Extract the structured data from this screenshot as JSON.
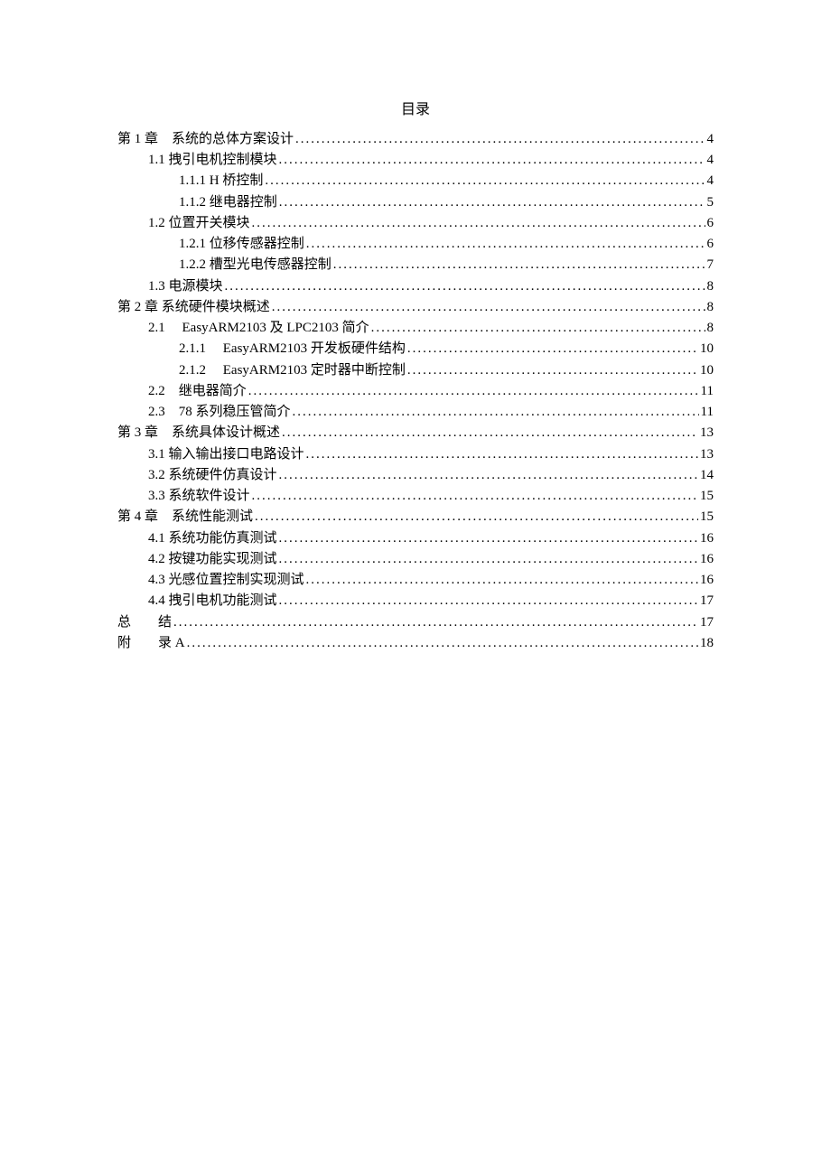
{
  "title": "目录",
  "toc": [
    {
      "indent": 0,
      "label": "第 1 章 系统的总体方案设计",
      "page": "4"
    },
    {
      "indent": 1,
      "label": "1.1 拽引电机控制模块",
      "page": "4"
    },
    {
      "indent": 2,
      "label": "1.1.1 H 桥控制",
      "page": "4"
    },
    {
      "indent": 2,
      "label": "1.1.2 继电器控制",
      "page": "5"
    },
    {
      "indent": 1,
      "label": "1.2 位置开关模块",
      "page": "6"
    },
    {
      "indent": 2,
      "label": "1.2.1 位移传感器控制",
      "page": "6"
    },
    {
      "indent": 2,
      "label": "1.2.2 槽型光电传感器控制",
      "page": "7"
    },
    {
      "indent": 1,
      "label": "1.3 电源模块",
      "page": "8"
    },
    {
      "indent": 0,
      "label": "第 2 章  系统硬件模块概述",
      "page": "8"
    },
    {
      "indent": 1,
      "label": "2.1  EasyARM2103 及 LPC2103 简介 ",
      "page": "8"
    },
    {
      "indent": 2,
      "label": "2.1.1  EasyARM2103 开发板硬件结构",
      "page": "10"
    },
    {
      "indent": 2,
      "label": "2.1.2  EasyARM2103 定时器中断控制",
      "page": "10"
    },
    {
      "indent": 1,
      "label": "2.2 继电器简介",
      "page": "11"
    },
    {
      "indent": 1,
      "label": "2.3 78 系列稳压管简介",
      "page": "11"
    },
    {
      "indent": 0,
      "label": "第 3 章 系统具体设计概述",
      "page": "13"
    },
    {
      "indent": 1,
      "label": "3.1 输入输出接口电路设计",
      "page": "13"
    },
    {
      "indent": 1,
      "label": "3.2 系统硬件仿真设计",
      "page": "14"
    },
    {
      "indent": 1,
      "label": "3.3 系统软件设计",
      "page": "15"
    },
    {
      "indent": 0,
      "label": "第  4  章 系统性能测试",
      "page": "15"
    },
    {
      "indent": 1,
      "label": "4.1 系统功能仿真测试",
      "page": "16"
    },
    {
      "indent": 1,
      "label": "4.2 按键功能实现测试",
      "page": "16"
    },
    {
      "indent": 1,
      "label": "4.3 光感位置控制实现测试",
      "page": "16"
    },
    {
      "indent": 1,
      "label": "4.4 拽引电机功能测试",
      "page": "17"
    },
    {
      "indent": 0,
      "label": "总  结",
      "page": "17"
    },
    {
      "indent": 0,
      "label": "附  录 A",
      "page": "18"
    }
  ]
}
